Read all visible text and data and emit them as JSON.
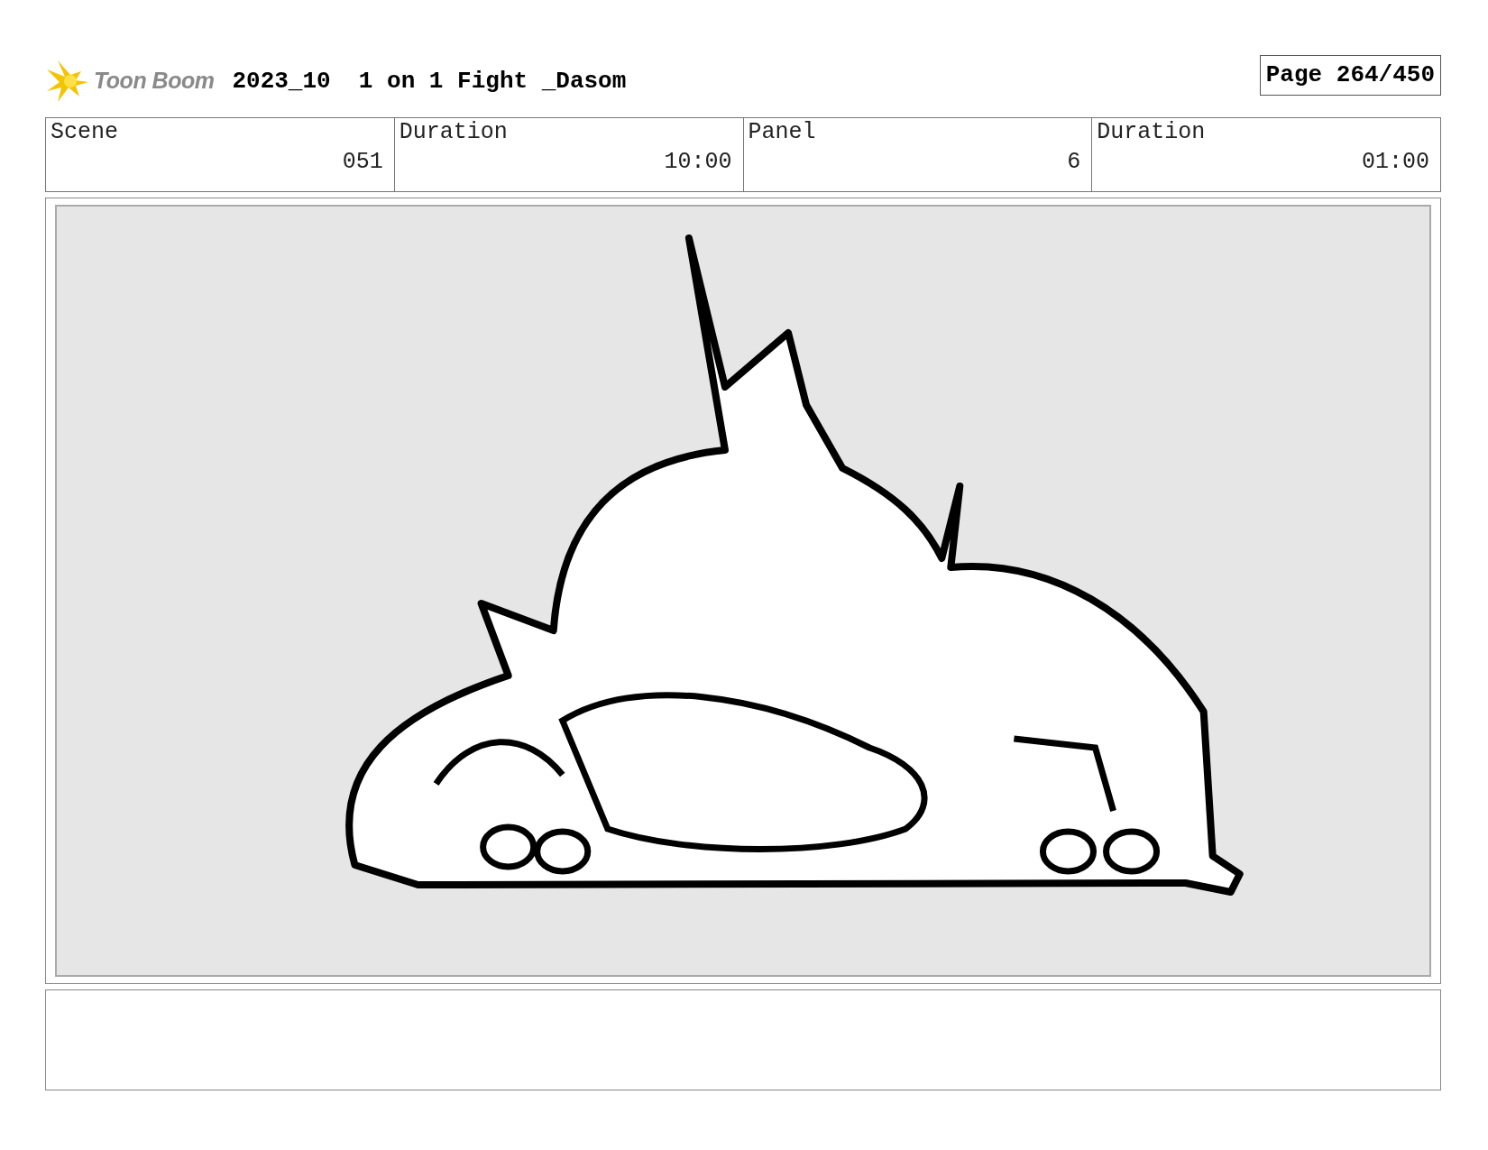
{
  "header": {
    "logo": "Toon Boom",
    "title": "2023_10  1 on 1 Fight _Dasom",
    "page": "Page 264/450"
  },
  "info_table": {
    "columns": [
      "Scene",
      "Duration",
      "Panel",
      "Duration"
    ],
    "values": [
      "051",
      "10:00",
      "6",
      "01:00"
    ]
  }
}
